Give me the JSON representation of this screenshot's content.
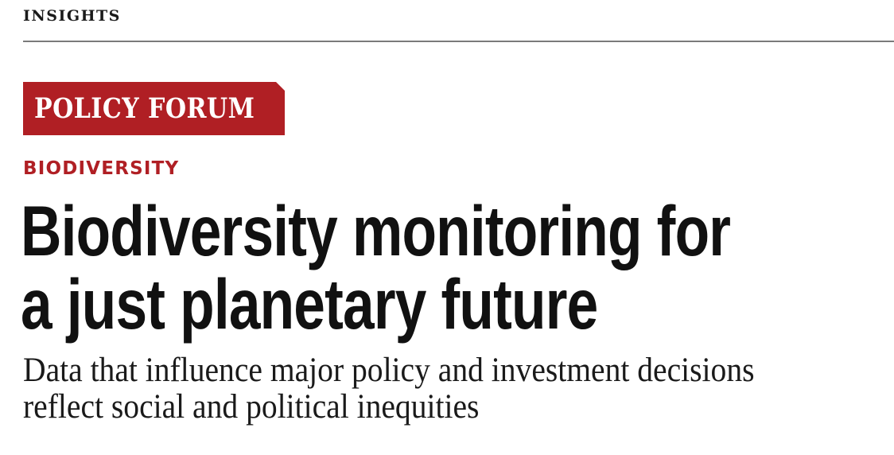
{
  "header": {
    "section_label": "INSIGHTS"
  },
  "badge": {
    "label": "POLICY FORUM",
    "color": "#b01f24"
  },
  "article": {
    "topic": "BIODIVERSITY",
    "title_line_1": "Biodiversity monitoring for",
    "title_line_2": "a just planetary future",
    "dek_line_1": "Data that influence major policy and investment decisions",
    "dek_line_2": "reflect social and political inequities"
  }
}
